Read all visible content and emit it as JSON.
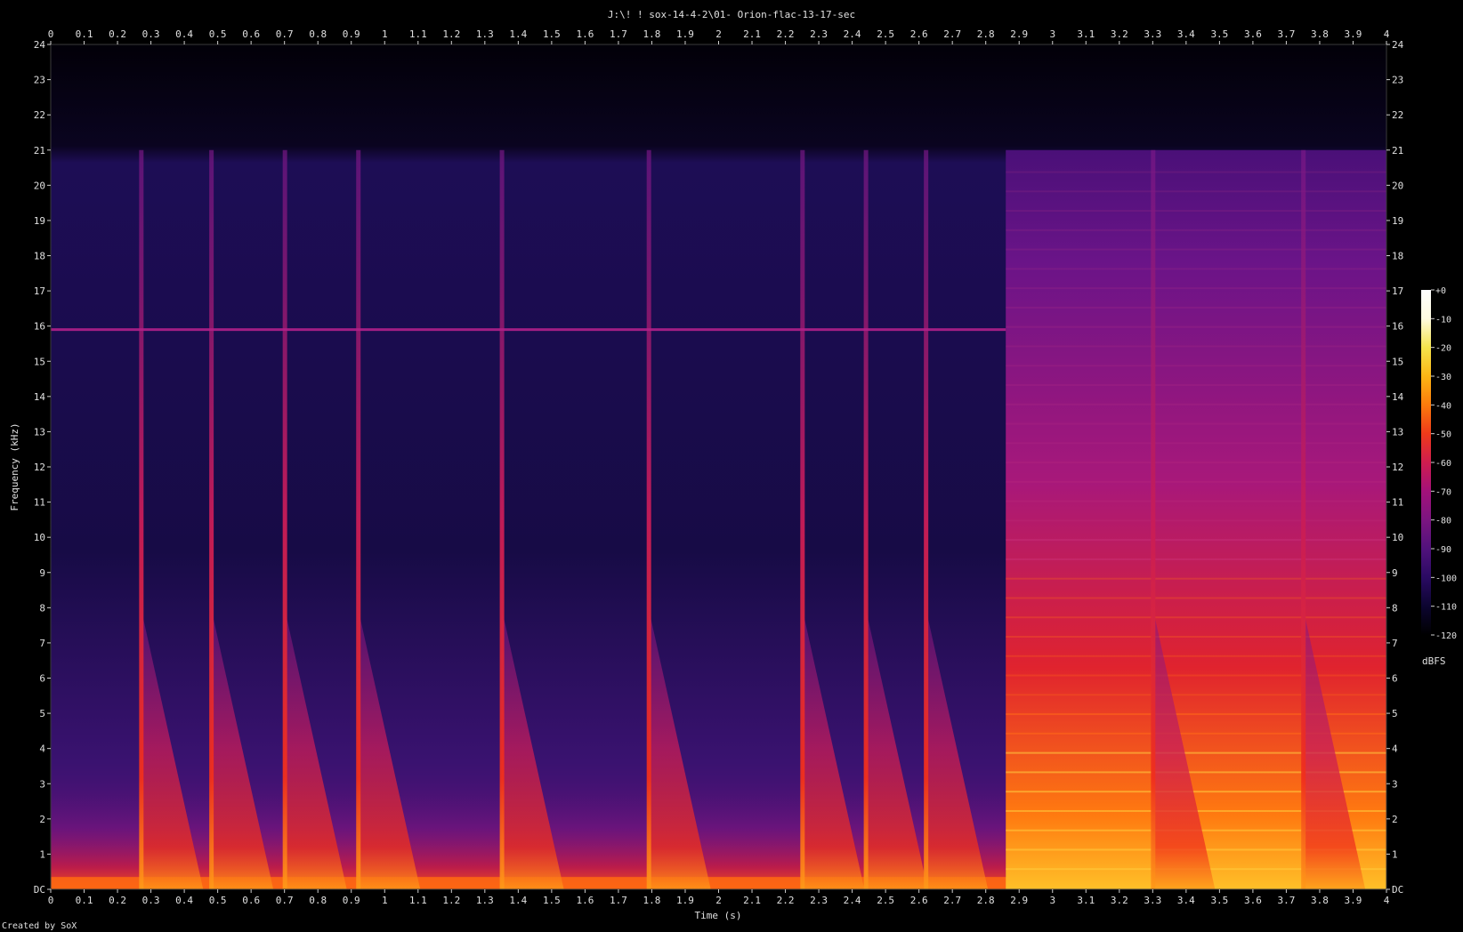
{
  "title": "J:\\! ! sox-14-4-2\\01- Orion-flac-13-17-sec",
  "footer": "Created by SoX",
  "chart_data": {
    "type": "heatmap",
    "title": "J:\\! ! sox-14-4-2\\01- Orion-flac-13-17-sec",
    "xlabel": "Time (s)",
    "ylabel": "Frequency (kHz)",
    "xlim": [
      0,
      4
    ],
    "ylim": [
      0,
      24
    ],
    "x_ticks": [
      "0",
      "0.1",
      "0.2",
      "0.3",
      "0.4",
      "0.5",
      "0.6",
      "0.7",
      "0.8",
      "0.9",
      "1",
      "1.1",
      "1.2",
      "1.3",
      "1.4",
      "1.5",
      "1.6",
      "1.7",
      "1.8",
      "1.9",
      "2",
      "2.1",
      "2.2",
      "2.3",
      "2.4",
      "2.5",
      "2.6",
      "2.7",
      "2.8",
      "2.9",
      "3",
      "3.1",
      "3.2",
      "3.3",
      "3.4",
      "3.5",
      "3.6",
      "3.7",
      "3.8",
      "3.9",
      "4"
    ],
    "y_ticks": [
      "DC",
      "1",
      "2",
      "3",
      "4",
      "5",
      "6",
      "7",
      "8",
      "9",
      "10",
      "11",
      "12",
      "13",
      "14",
      "15",
      "16",
      "17",
      "18",
      "19",
      "20",
      "21",
      "22",
      "23",
      "24"
    ],
    "colorbar": {
      "label": "dBFS",
      "range": [
        -120,
        0
      ],
      "ticks": [
        "+0",
        "-10",
        "-20",
        "-30",
        "-40",
        "-50",
        "-60",
        "-70",
        "-80",
        "-90",
        "-100",
        "-110",
        "-120"
      ],
      "colors": [
        "#000000",
        "#0c0530",
        "#2a0a63",
        "#51127c",
        "#7b1580",
        "#a3117a",
        "#cf1d4f",
        "#ee3a1a",
        "#fb7b0c",
        "#fcb614",
        "#f5e44c",
        "#fffbe0",
        "#ffffff"
      ]
    },
    "onsets_s": [
      0.27,
      0.48,
      0.7,
      0.92,
      1.35,
      1.79,
      2.25,
      2.44,
      2.62,
      3.3,
      3.75
    ],
    "sustained_region_s": [
      2.86,
      4.0
    ],
    "constant_tone_khz": 15.9,
    "constant_tone_span_s": [
      0,
      2.86
    ],
    "rolloff_khz": 21
  }
}
